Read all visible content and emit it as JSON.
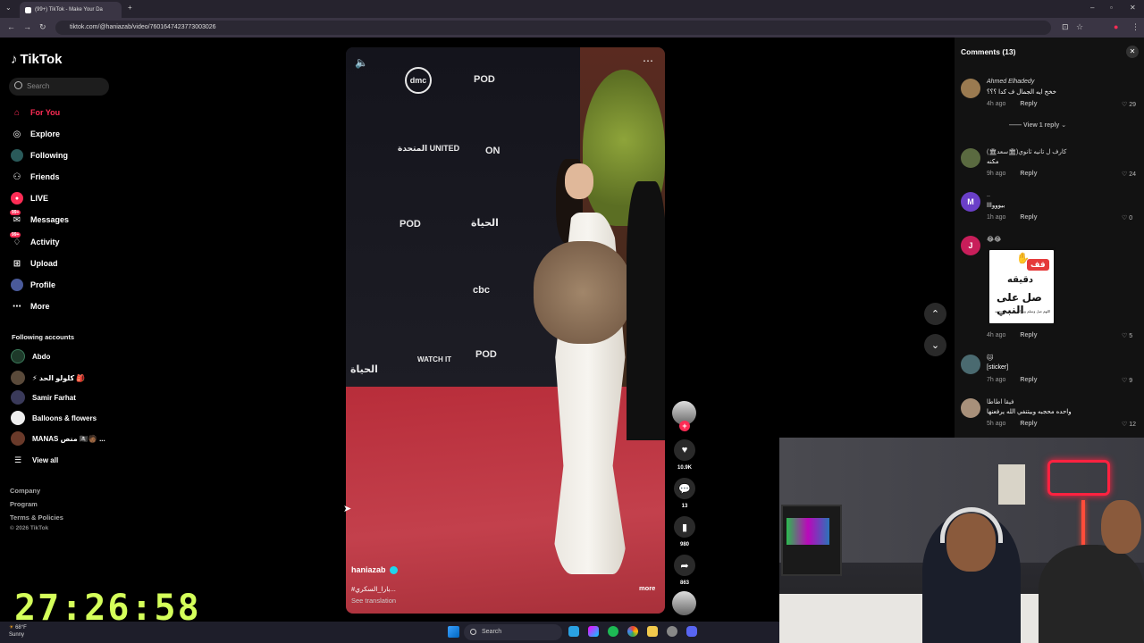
{
  "browser": {
    "tab_title": "(99+) TikTok - Make Your Da",
    "url": "tiktok.com/@haniazab/video/7601647423773003026"
  },
  "sidebar": {
    "logo": "TikTok",
    "search_placeholder": "Search",
    "nav": [
      {
        "label": "For You",
        "icon": "home-icon",
        "active": true
      },
      {
        "label": "Explore",
        "icon": "compass-icon"
      },
      {
        "label": "Following",
        "icon": "following-icon"
      },
      {
        "label": "Friends",
        "icon": "friends-icon"
      },
      {
        "label": "LIVE",
        "icon": "live-icon"
      },
      {
        "label": "Messages",
        "icon": "messages-icon",
        "badge": "99+"
      },
      {
        "label": "Activity",
        "icon": "activity-icon",
        "badge": "99+"
      },
      {
        "label": "Upload",
        "icon": "upload-icon"
      },
      {
        "label": "Profile",
        "icon": "profile-icon"
      },
      {
        "label": "More",
        "icon": "more-icon"
      }
    ],
    "following_title": "Following accounts",
    "accounts": [
      {
        "name": "Abdo"
      },
      {
        "name": "⚡ كلولو الحد 🎒"
      },
      {
        "name": "Samir Farhat"
      },
      {
        "name": "Balloons & flowers"
      },
      {
        "name": "MANAS منص 🏴‍☠️🧑🏾 ..."
      }
    ],
    "view_all": "View all",
    "footer": [
      "Company",
      "Program",
      "Terms & Policies",
      "© 2026 TikTok"
    ]
  },
  "video": {
    "username": "haniazab",
    "caption": "#بارا_السكري...",
    "see_translation": "See translation",
    "more": "more",
    "sponsors": [
      "dmc",
      "POD",
      "المتحدة UNITED",
      "ON",
      "الحياة",
      "WATCH IT",
      "cbc"
    ]
  },
  "actions": {
    "likes": "10.9K",
    "comments": "13",
    "saves": "980",
    "shares": "863"
  },
  "comments": {
    "title": "Comments",
    "count": "(13)",
    "view_reply": "View 1 reply",
    "items": [
      {
        "name": "Ahmed Elhadedy",
        "text": "خخخ ايه الجمال ف كدا ؟؟؟",
        "time": "4h ago",
        "reply": "Reply",
        "likes": "29",
        "avatar": "#9a7a50"
      },
      {
        "name": "كارف ل تانيه ثانوي(🏛سعد🏛)",
        "text": "مكنه",
        "time": "9h ago",
        "reply": "Reply",
        "likes": "24",
        "avatar": "#5a6a40"
      },
      {
        "name": "..",
        "text": "بيوووااا",
        "time": "1h ago",
        "reply": "Reply",
        "likes": "0",
        "avatar": "#6a3fc8",
        "initial": "M"
      },
      {
        "name": "😂😂",
        "text": "",
        "time": "4h ago",
        "reply": "Reply",
        "likes": "5",
        "avatar": "#c81e5a",
        "initial": "J"
      },
      {
        "name": "🐱",
        "text": "[sticker]",
        "time": "7h ago",
        "reply": "Reply",
        "likes": "9",
        "avatar": "#4a6a70"
      },
      {
        "name": "فيقا اطاطا",
        "text": "واحده محجبه وبيتنفي الله يرفعنها",
        "time": "5h ago",
        "reply": "Reply",
        "likes": "12",
        "avatar": "#a8907a"
      }
    ],
    "sticker": {
      "line1": "قف",
      "line2": "دقيقه",
      "line3": "صل على النبي",
      "line4": "اللهم صل وسلم وبارك على نبينا محمد"
    }
  },
  "overlay": {
    "timer": "27:26:58"
  },
  "taskbar": {
    "weather_temp": "68°F",
    "weather_text": "Sunny",
    "search": "Search"
  },
  "colors": {
    "accent": "#fe2c55",
    "timer": "#d4ff5a",
    "verified": "#20d5ec"
  }
}
